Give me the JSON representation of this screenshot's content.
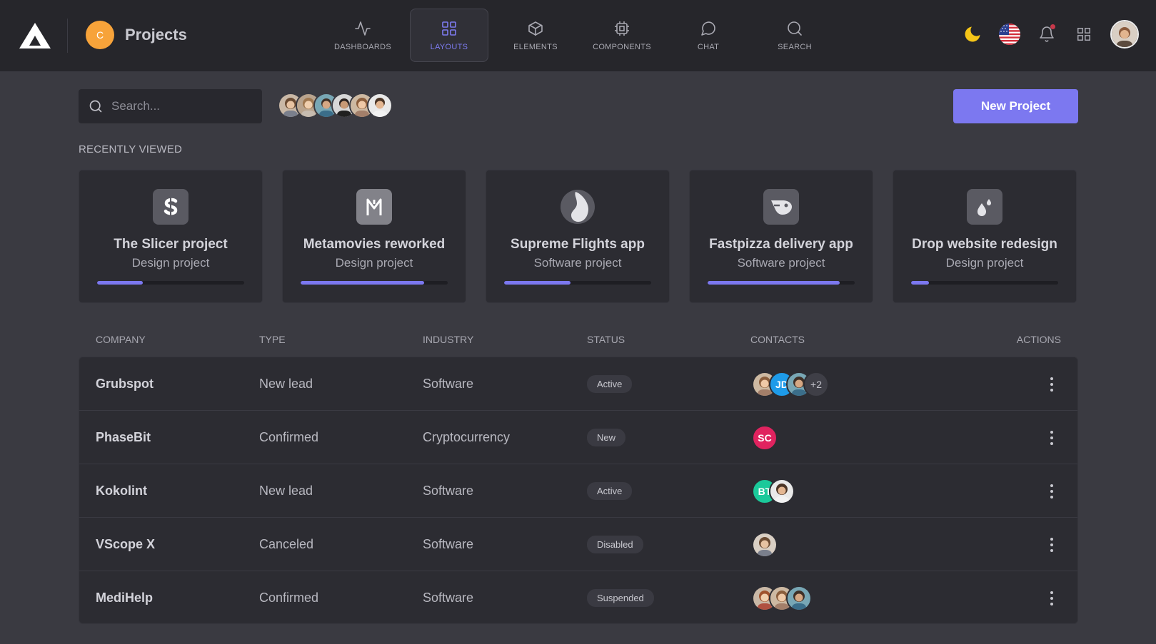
{
  "app": {
    "badge_letter": "C",
    "title": "Projects"
  },
  "nav": [
    {
      "label": "DASHBOARDS",
      "icon": "activity-icon"
    },
    {
      "label": "LAYOUTS",
      "icon": "grid-icon",
      "active": true
    },
    {
      "label": "ELEMENTS",
      "icon": "cube-icon"
    },
    {
      "label": "COMPONENTS",
      "icon": "chip-icon"
    },
    {
      "label": "CHAT",
      "icon": "chat-icon"
    },
    {
      "label": "SEARCH",
      "icon": "search-icon"
    }
  ],
  "search": {
    "placeholder": "Search...",
    "value": ""
  },
  "toolbar": {
    "new_project_label": "New Project"
  },
  "recently_viewed": {
    "label": "RECENTLY VIEWED",
    "cards": [
      {
        "title": "The Slicer project",
        "subtitle": "Design project",
        "progress": 0.31,
        "icon": "slicer-logo-icon"
      },
      {
        "title": "Metamovies reworked",
        "subtitle": "Design project",
        "progress": 0.84,
        "icon": "metamovies-logo-icon"
      },
      {
        "title": "Supreme Flights app",
        "subtitle": "Software project",
        "progress": 0.45,
        "icon": "supreme-logo-icon"
      },
      {
        "title": "Fastpizza delivery app",
        "subtitle": "Software project",
        "progress": 0.9,
        "icon": "fastpizza-logo-icon"
      },
      {
        "title": "Drop website redesign",
        "subtitle": "Design project",
        "progress": 0.12,
        "icon": "drop-logo-icon"
      }
    ]
  },
  "table": {
    "headers": {
      "company": "COMPANY",
      "type": "TYPE",
      "industry": "INDUSTRY",
      "status": "STATUS",
      "contacts": "CONTACTS",
      "actions": "ACTIONS"
    },
    "rows": [
      {
        "company": "Grubspot",
        "type": "New lead",
        "industry": "Software",
        "status": "Active",
        "contacts": [
          {
            "kind": "photo"
          },
          {
            "kind": "initials",
            "text": "JD",
            "color": "#1e9be9"
          },
          {
            "kind": "photo"
          },
          {
            "kind": "more",
            "text": "+2"
          }
        ]
      },
      {
        "company": "PhaseBit",
        "type": "Confirmed",
        "industry": "Cryptocurrency",
        "status": "New",
        "contacts": [
          {
            "kind": "initials",
            "text": "SC",
            "color": "#e0235f"
          }
        ]
      },
      {
        "company": "Kokolint",
        "type": "New lead",
        "industry": "Software",
        "status": "Active",
        "contacts": [
          {
            "kind": "initials",
            "text": "BT",
            "color": "#1bc99a"
          },
          {
            "kind": "photo"
          }
        ]
      },
      {
        "company": "VScope X",
        "type": "Canceled",
        "industry": "Software",
        "status": "Disabled",
        "contacts": [
          {
            "kind": "photo"
          }
        ]
      },
      {
        "company": "MediHelp",
        "type": "Confirmed",
        "industry": "Software",
        "status": "Suspended",
        "contacts": [
          {
            "kind": "photo"
          },
          {
            "kind": "photo"
          },
          {
            "kind": "photo"
          }
        ]
      }
    ]
  },
  "colors": {
    "accent": "#7c78f0",
    "topbar": "#26262b",
    "background": "#3a3a41",
    "card": "#2c2c32",
    "badge": "#f7a33a"
  }
}
